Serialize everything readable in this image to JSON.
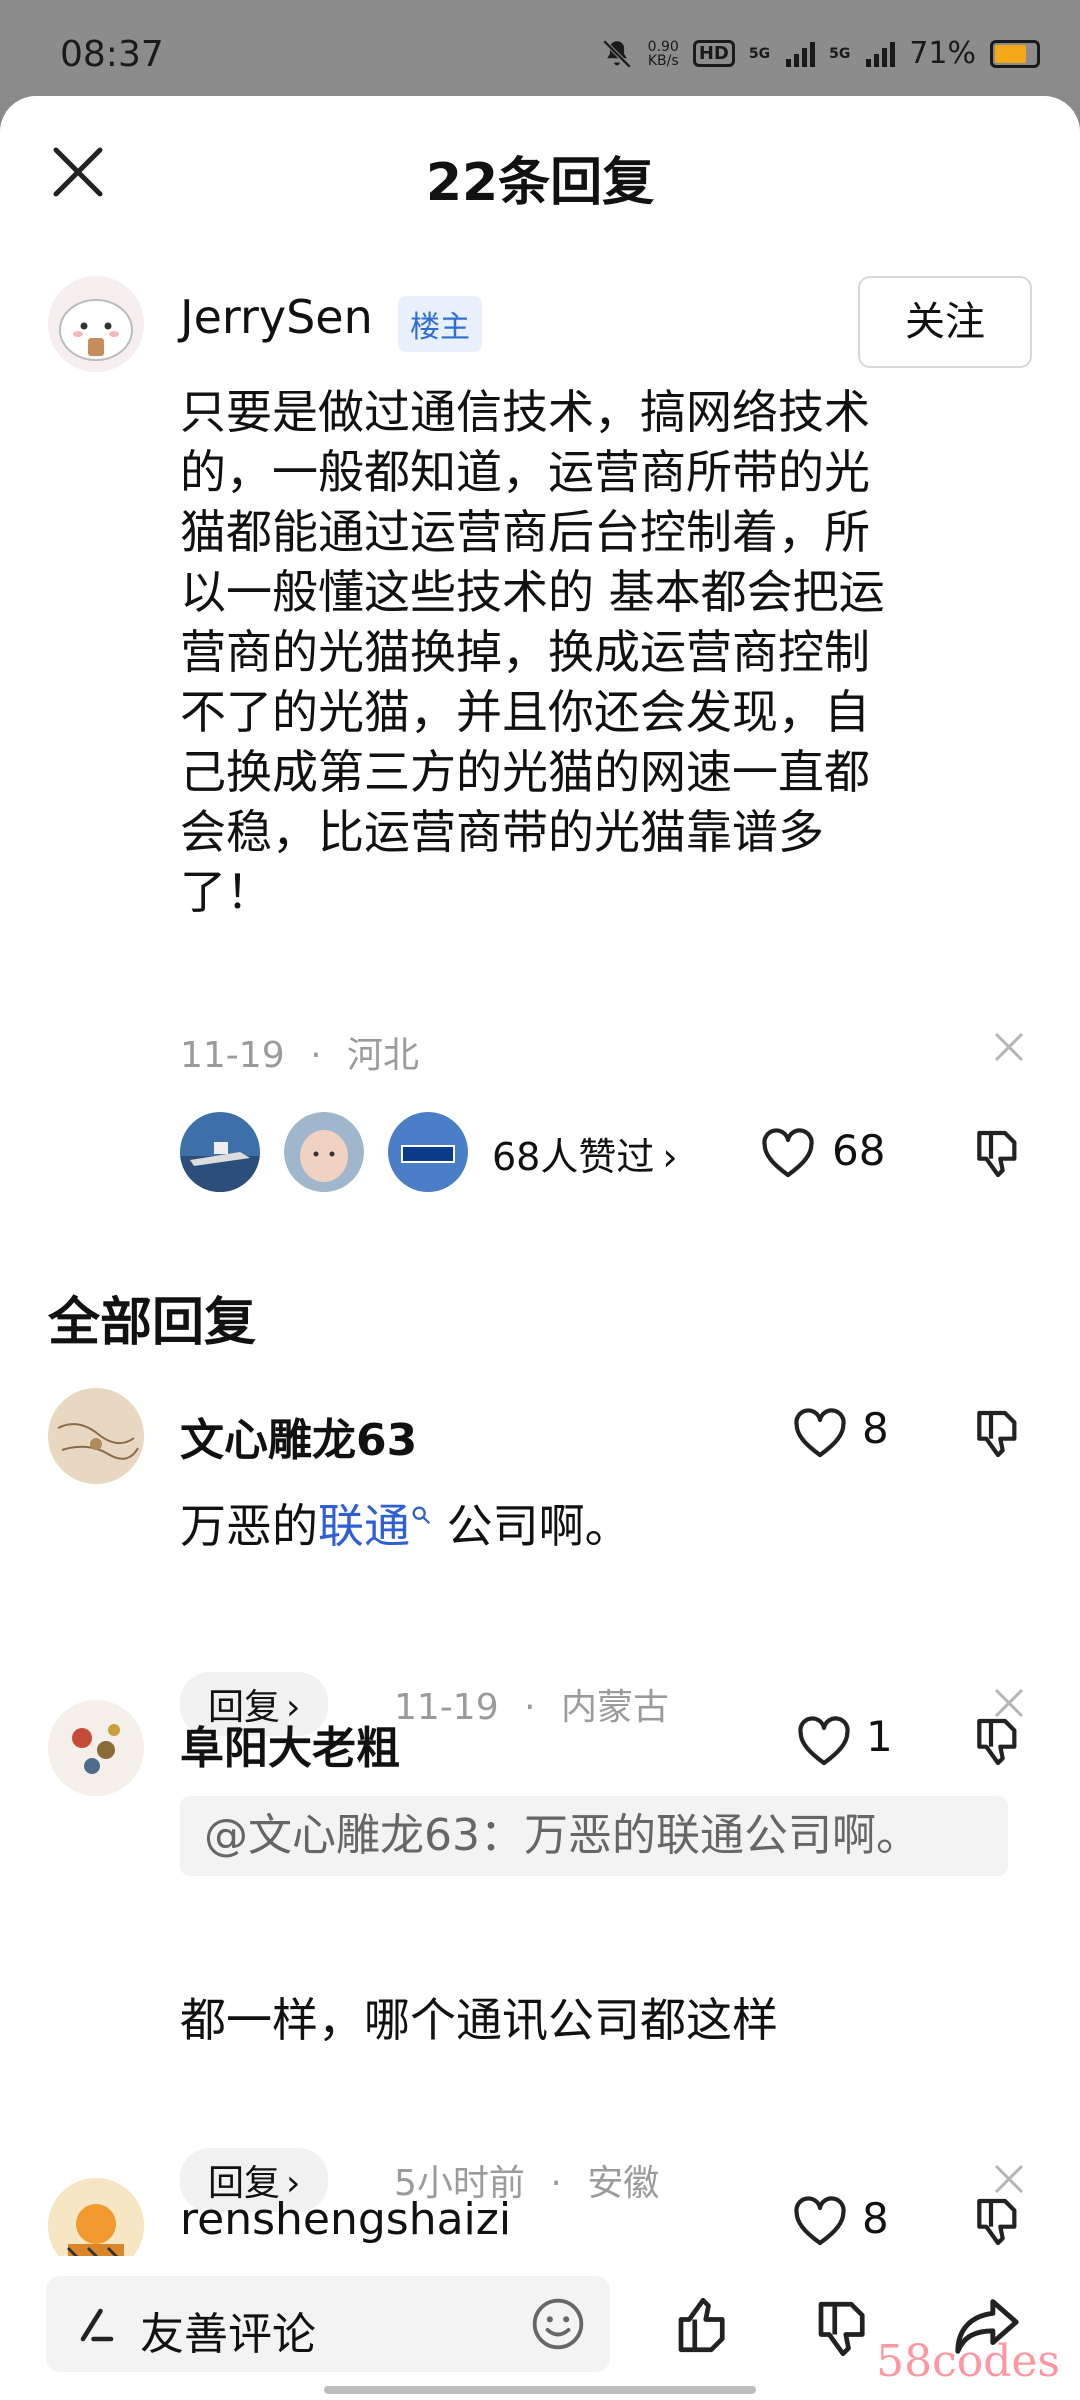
{
  "status_bar": {
    "time": "08:37",
    "net_speed_value": "0.90",
    "net_speed_unit": "KB/s",
    "hd_label": "HD",
    "net1": "5G",
    "net2": "5G",
    "battery": "71%",
    "battery_color": "#f3a91a"
  },
  "header": {
    "title": "22条回复"
  },
  "post": {
    "author": "JerrySen",
    "badge": "楼主",
    "follow": "关注",
    "text": "只要是做过通信技术，搞网络技术\n的，一般都知道，运营商所带的光\n猫都能通过运营商后台控制着，所\n以一般懂这些技术的 基本都会把运\n营商的光猫换掉，换成运营商控制\n不了的光猫，并且你还会发现，自\n己换成第三方的光猫的网速一直都\n会稳，比运营商带的光猫靠谱多\n了！",
    "date": "11-19",
    "dot": "·",
    "location": "河北",
    "liked_by": "68人赞过",
    "like_count": "68"
  },
  "section_title": "全部回复",
  "comments": [
    {
      "name": "文心雕龙63",
      "likes": "8",
      "text_before": "万恶的",
      "link": "联通",
      "text_after": " 公司啊。",
      "reply": "回复",
      "date": "11-19",
      "dot": "·",
      "location": "内蒙古"
    },
    {
      "name": "阜阳大老粗",
      "likes": "1",
      "quote": "@文心雕龙63：万恶的联通公司啊。",
      "text": "都一样，哪个通讯公司都这样",
      "reply": "回复",
      "date": "5小时前",
      "dot": "·",
      "location": "安徽"
    },
    {
      "name": "renshengshaizi",
      "likes": "8"
    }
  ],
  "bottom": {
    "placeholder": "友善评论",
    "watermark": "58codes"
  },
  "colors": {
    "link": "#2f5fd2",
    "badge": "#2f6ed2",
    "meta": "#9b9b9b"
  }
}
